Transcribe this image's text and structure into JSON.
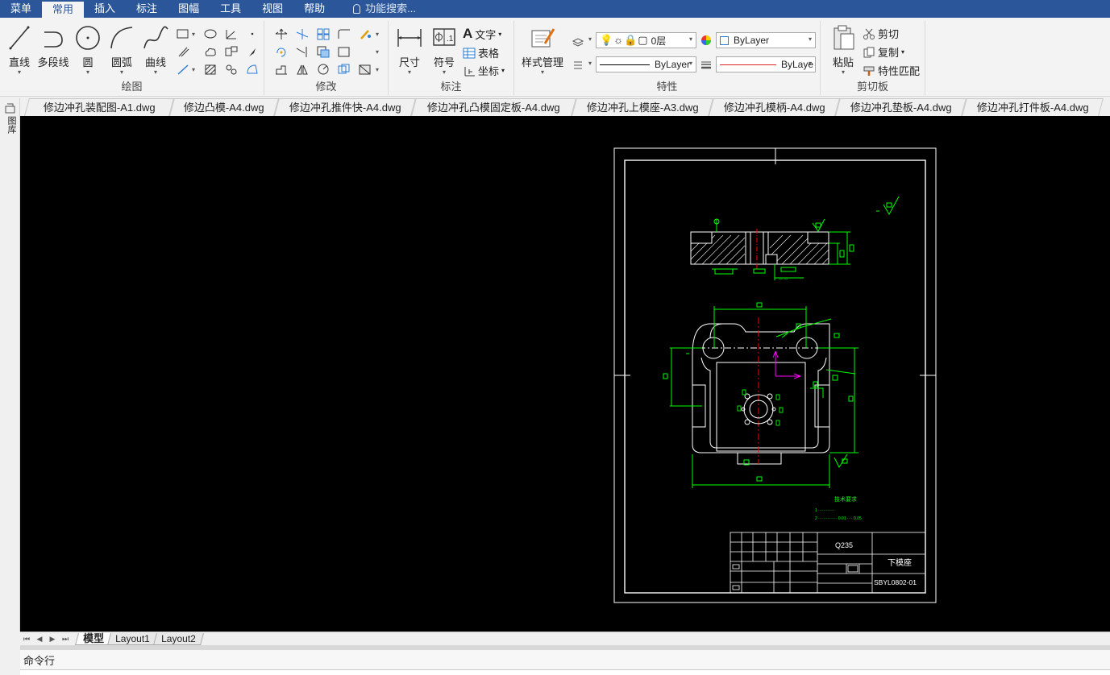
{
  "menubar": {
    "items": [
      "菜单",
      "常用",
      "插入",
      "标注",
      "图幅",
      "工具",
      "视图",
      "帮助"
    ],
    "active": "常用",
    "search_placeholder": "功能搜索..."
  },
  "ribbon": {
    "groups": {
      "draw": "绘图",
      "modify": "修改",
      "annotate": "标注",
      "properties": "特性",
      "clipboard": "剪切板"
    },
    "draw_buttons": [
      "直线",
      "多段线",
      "圆",
      "圆弧",
      "曲线"
    ],
    "annotate_buttons": {
      "dimension": "尺寸",
      "symbol": "符号",
      "text": "文字",
      "table": "表格",
      "coordinate": "坐标"
    },
    "style_manager": "样式管理",
    "layer_value": "0层",
    "color_value": "ByLayer",
    "linetype_value": "ByLayer",
    "lineweight_value": "ByLaye",
    "clipboard": {
      "paste": "粘贴",
      "cut": "剪切",
      "copy": "复制",
      "match": "特性匹配"
    }
  },
  "doc_tabs": [
    "修边冲孔装配图-A1.dwg",
    "修边凸模-A4.dwg",
    "修边冲孔推件快-A4.dwg",
    "修边冲孔凸模固定板-A4.dwg",
    "修边冲孔上模座-A3.dwg",
    "修边冲孔模柄-A4.dwg",
    "修边冲孔垫板-A4.dwg",
    "修边冲孔打件板-A4.dwg"
  ],
  "left_strip_label": "图库",
  "drawing": {
    "material": "Q235",
    "part_name": "下模座",
    "drawing_no": "SBYL0802-01",
    "tech_title": "技术要求"
  },
  "layout_tabs": [
    "模型",
    "Layout1",
    "Layout2"
  ],
  "command_label": "命令行",
  "colors": {
    "menubar": "#2b579a",
    "canvas": "#000000",
    "dim_green": "#00ff00",
    "center_red": "#ff0000",
    "ucs_magenta": "#ff00ff"
  }
}
